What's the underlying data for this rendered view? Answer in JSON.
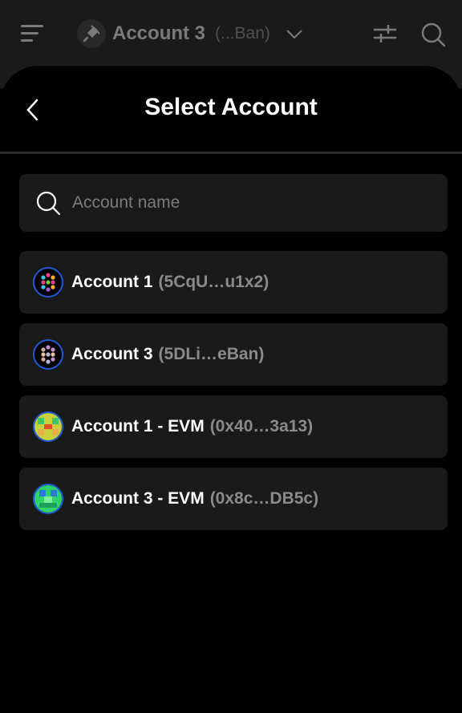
{
  "header": {
    "account_name": "Account 3",
    "account_addr": "(...Ban)",
    "icons": [
      "menu-icon",
      "plug-icon",
      "chevron-down-icon",
      "sliders-icon",
      "search-icon"
    ]
  },
  "sheet": {
    "title": "Select Account",
    "back_icon": "chevron-left-icon"
  },
  "search": {
    "placeholder": "Account name",
    "value": ""
  },
  "accounts": [
    {
      "name": "Account 1",
      "addr": "(5CqU…u1x2)",
      "avatar": "polkadot-identicon"
    },
    {
      "name": "Account 3",
      "addr": "(5DLi…eBan)",
      "avatar": "polkadot-identicon"
    },
    {
      "name": "Account 1 - EVM",
      "addr": "(0x40…3a13)",
      "avatar": "evm-blockie"
    },
    {
      "name": "Account 3 - EVM",
      "addr": "(0x8c…DB5c)",
      "avatar": "evm-blockie"
    }
  ],
  "colors": {
    "background": "#000000",
    "card": "#1a1a1a",
    "avatar_ring": "#1f5bd6",
    "secondary_text": "#8a8a8a"
  }
}
